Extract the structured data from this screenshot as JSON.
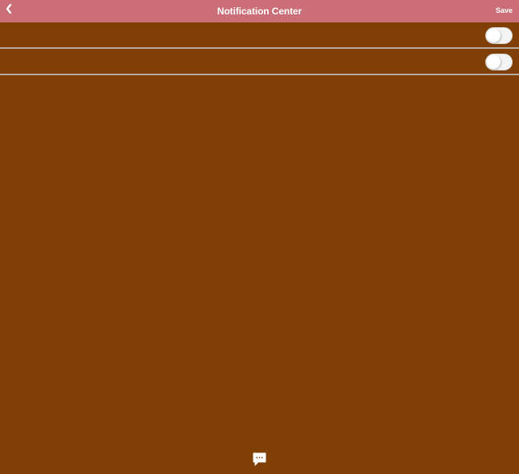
{
  "header": {
    "title": "Notification Center",
    "save_label": "Save",
    "back_icon": "chevron-left-icon",
    "background": "#cb6e78"
  },
  "settings": [
    {
      "label": "",
      "enabled": false
    },
    {
      "label": "",
      "enabled": false
    }
  ],
  "footer": {
    "chat_icon": "chat-bubble-icon"
  },
  "colors": {
    "page_background": "#7f3f05",
    "divider": "#b7a9a4",
    "header_text": "#ffffff"
  }
}
